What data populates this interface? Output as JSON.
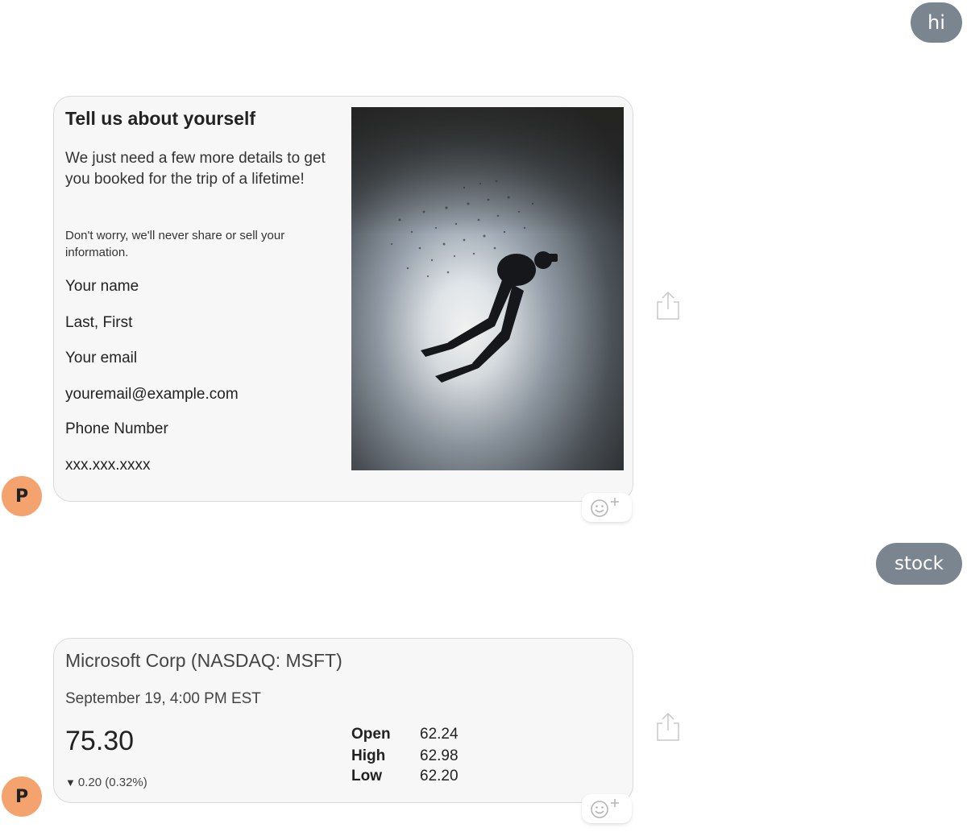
{
  "chat": {
    "user_messages": [
      "hi",
      "stock"
    ],
    "bot_initial": "P"
  },
  "form_card": {
    "title": "Tell us about yourself",
    "intro": "We just need a few more details to get you booked for the trip of a lifetime!",
    "note": "Don't worry, we'll never share or sell your information.",
    "fields": [
      {
        "label": "Your name",
        "placeholder": "Last, First"
      },
      {
        "label": "Your email",
        "placeholder": "youremail@example.com"
      },
      {
        "label": "Phone Number",
        "placeholder": "xxx.xxx.xxxx"
      }
    ]
  },
  "stock_card": {
    "name": "Microsoft Corp (NASDAQ: MSFT)",
    "date": "September 19, 4:00 PM EST",
    "price": "75.30",
    "change_arrow": "▼",
    "change": "0.20 (0.32%)",
    "stats": [
      {
        "label": "Open",
        "value": "62.24"
      },
      {
        "label": "High",
        "value": "62.98"
      },
      {
        "label": "Low",
        "value": "62.20"
      }
    ]
  },
  "icons": {
    "share": "share-icon",
    "reaction": "add-reaction-icon"
  },
  "colors": {
    "user_bubble": "#7a8590",
    "avatar": "#f4a36e",
    "card_bg": "#f7f7f7"
  }
}
